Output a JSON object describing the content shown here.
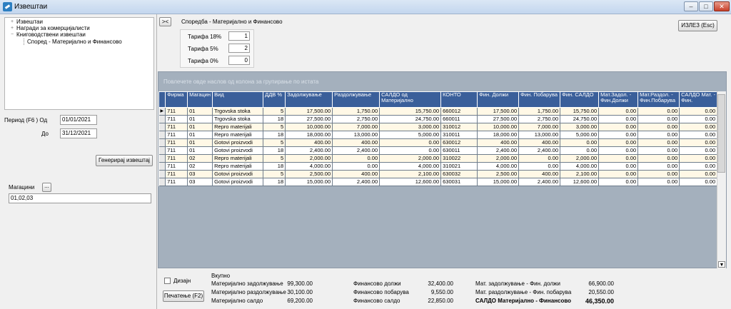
{
  "window": {
    "title": "Извештаи"
  },
  "tree": {
    "items": [
      {
        "label": "Извештаи",
        "exp": "+"
      },
      {
        "label": "Награди за комерцијалисти",
        "exp": "+"
      },
      {
        "label": "Книговодствени извештаи",
        "exp": "−"
      },
      {
        "label": "Според - Материјално и Финансово",
        "exp": ""
      }
    ]
  },
  "period": {
    "label": "Период (F6 ) Од",
    "from": "01/01/2021",
    "to_label": "До",
    "to": "31/12/2021"
  },
  "generate_button": "Генерирај извештај",
  "magacini": {
    "label": "Магацини",
    "browse": "...",
    "value": "01,02,03"
  },
  "header": {
    "collapse_button": "><",
    "report_title": "Споредба - Материјално и Финансово",
    "exit_button": "ИЗЛЕЗ (Esc)"
  },
  "tarifi": [
    {
      "label": "Тарифа 18%",
      "value": "1"
    },
    {
      "label": "Тарифа 5%",
      "value": "2"
    },
    {
      "label": "Тарифа 0%",
      "value": "0"
    }
  ],
  "grid": {
    "group_hint": "Повлечете овде наслов од колона за групирање по истата",
    "columns": [
      "Фирма",
      "Магацин",
      "Вид",
      "ДДВ %",
      "Задолжување",
      "Раздолжување",
      "САЛДО од Материјално",
      "КОНТО",
      "Фин. Должи",
      "Фин. Побарува",
      "Фин. САЛДО",
      "Мат.Задол. - Фин.Должи",
      "Мат.Раздол. - Фин.Побарува",
      "САЛДО Мат. - Фин."
    ],
    "rows": [
      [
        "711",
        "01",
        "Trgovska stoka",
        "5",
        "17,500.00",
        "1,750.00",
        "15,750.00",
        "660012",
        "17,500.00",
        "1,750.00",
        "15,750.00",
        "0.00",
        "0.00",
        "0.00"
      ],
      [
        "711",
        "01",
        "Trgovska stoka",
        "18",
        "27,500.00",
        "2,750.00",
        "24,750.00",
        "660011",
        "27,500.00",
        "2,750.00",
        "24,750.00",
        "0.00",
        "0.00",
        "0.00"
      ],
      [
        "711",
        "01",
        "Repro materijali",
        "5",
        "10,000.00",
        "7,000.00",
        "3,000.00",
        "310012",
        "10,000.00",
        "7,000.00",
        "3,000.00",
        "0.00",
        "0.00",
        "0.00"
      ],
      [
        "711",
        "01",
        "Repro materijali",
        "18",
        "18,000.00",
        "13,000.00",
        "5,000.00",
        "310011",
        "18,000.00",
        "13,000.00",
        "5,000.00",
        "0.00",
        "0.00",
        "0.00"
      ],
      [
        "711",
        "01",
        "Gotovi proizvodi",
        "5",
        "400.00",
        "400.00",
        "0.00",
        "630012",
        "400.00",
        "400.00",
        "0.00",
        "0.00",
        "0.00",
        "0.00"
      ],
      [
        "711",
        "01",
        "Gotovi proizvodi",
        "18",
        "2,400.00",
        "2,400.00",
        "0.00",
        "630011",
        "2,400.00",
        "2,400.00",
        "0.00",
        "0.00",
        "0.00",
        "0.00"
      ],
      [
        "711",
        "02",
        "Repro materijali",
        "5",
        "2,000.00",
        "0.00",
        "2,000.00",
        "310022",
        "2,000.00",
        "0.00",
        "2,000.00",
        "0.00",
        "0.00",
        "0.00"
      ],
      [
        "711",
        "02",
        "Repro materijali",
        "18",
        "4,000.00",
        "0.00",
        "4,000.00",
        "310021",
        "4,000.00",
        "0.00",
        "4,000.00",
        "0.00",
        "0.00",
        "0.00"
      ],
      [
        "711",
        "03",
        "Gotovi proizvodi",
        "5",
        "2,500.00",
        "400.00",
        "2,100.00",
        "630032",
        "2,500.00",
        "400.00",
        "2,100.00",
        "0.00",
        "0.00",
        "0.00"
      ],
      [
        "711",
        "03",
        "Gotovi proizvodi",
        "18",
        "15,000.00",
        "2,400.00",
        "12,600.00",
        "630031",
        "15,000.00",
        "2,400.00",
        "12,600.00",
        "0.00",
        "0.00",
        "0.00"
      ]
    ]
  },
  "bottom": {
    "design_label": "Дизајн",
    "print_button": "Печатење (F2)",
    "vkupno": "Вкупно",
    "col1": [
      {
        "label": "Материјално задолжување",
        "value": "99,300.00"
      },
      {
        "label": "Материјално раздолжување",
        "value": "30,100.00"
      },
      {
        "label": "Материјално салдо",
        "value": "69,200.00"
      }
    ],
    "col2": [
      {
        "label": "Финансово должи",
        "value": "32,400.00"
      },
      {
        "label": "Финансово побарува",
        "value": "9,550.00"
      },
      {
        "label": "Финансово салдо",
        "value": "22,850.00"
      }
    ],
    "col3": [
      {
        "label": "Мат. задолжување - Фин. должи",
        "value": "66,900.00"
      },
      {
        "label": "Мат. раздолжување - Фин. побарува",
        "value": "20,550.00"
      },
      {
        "label": "САЛДО Материјално - Финансово",
        "value": "46,350.00"
      }
    ]
  }
}
